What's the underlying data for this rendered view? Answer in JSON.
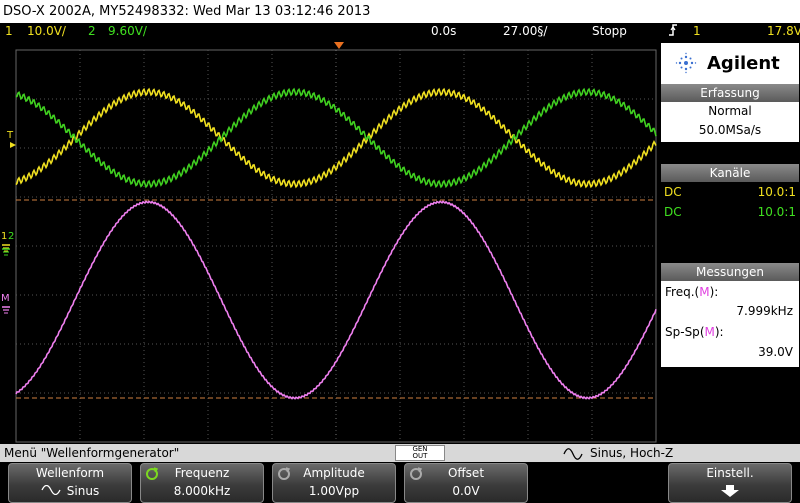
{
  "title_bar": {
    "text": "DSO-X 2002A, MY52498332: Wed Mar 13 03:12:46 2013"
  },
  "status": {
    "ch1_num": "1",
    "ch1_scale": "10.0V/",
    "ch2_num": "2",
    "ch2_scale": "9.60V/",
    "time_delay": "0.0s",
    "time_scale": "27.00§/",
    "run_state": "Stopp",
    "trigger_source": "1",
    "trigger_level": "17.8V"
  },
  "panel": {
    "brand": "Agilent",
    "acq_header": "Erfassung",
    "acq_mode": "Normal",
    "sample_rate": "50.0MSa/s",
    "channels_header": "Kanäle",
    "channels": [
      {
        "coupling": "DC",
        "probe": "10.0:1",
        "color": "#f0e020"
      },
      {
        "coupling": "DC",
        "probe": "10.0:1",
        "color": "#40e020"
      }
    ],
    "meas_header": "Messungen",
    "meas": [
      {
        "label": "Freq.",
        "src": "M",
        "suffix": ":",
        "value": "7.999kHz"
      },
      {
        "label": "Sp-Sp",
        "src": "M",
        "suffix": ":",
        "value": "39.0V"
      }
    ]
  },
  "screen": {
    "marker_T": "T",
    "marker_1": "1",
    "marker_2": "2",
    "marker_M": "M"
  },
  "waveforms": {
    "ch1_color": "#f0e020",
    "ch2_color": "#40d020",
    "math_color": "#f080f0",
    "cursor_color": "#d08040"
  },
  "menu": {
    "title": "Menü \"Wellenformgenerator\"",
    "gen_out": [
      "GEN",
      "OUT"
    ],
    "gen_status": "Sinus, Hoch-Z"
  },
  "softkeys": [
    {
      "top": "Wellenform",
      "bottom": "Sinus"
    },
    {
      "top": "Frequenz",
      "bottom": "8.000kHz"
    },
    {
      "top": "Amplitude",
      "bottom": "1.00Vpp"
    },
    {
      "top": "Offset",
      "bottom": "0.0V"
    },
    {
      "top": "Einstell.",
      "bottom": ""
    }
  ]
}
